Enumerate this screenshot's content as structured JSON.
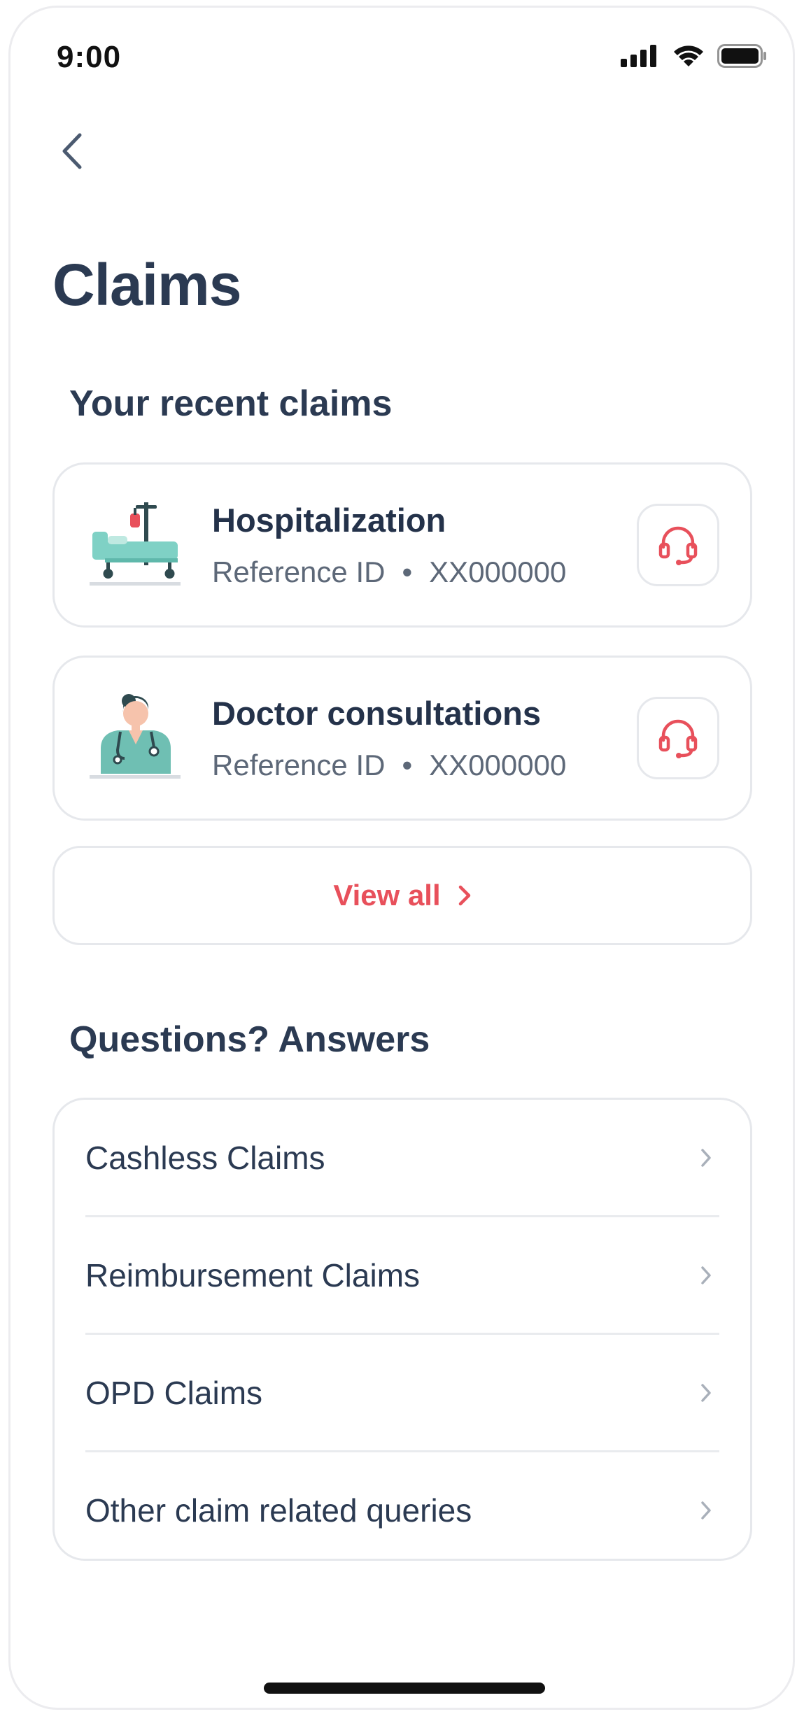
{
  "status_bar": {
    "time": "9:00",
    "icons": [
      "signal-icon",
      "wifi-icon",
      "battery-icon"
    ]
  },
  "nav": {
    "back_icon": "chevron-left-icon"
  },
  "page": {
    "title": "Claims"
  },
  "recent_claims": {
    "heading": "Your recent claims",
    "items": [
      {
        "title": "Hospitalization",
        "ref_label": "Reference ID",
        "separator": "•",
        "ref_value": "XX000000",
        "illustration": "hospital-bed-icon",
        "action_icon": "headset-icon"
      },
      {
        "title": "Doctor consultations",
        "ref_label": "Reference ID",
        "separator": "•",
        "ref_value": "XX000000",
        "illustration": "doctor-icon",
        "action_icon": "headset-icon"
      }
    ],
    "view_all_label": "View all"
  },
  "faq": {
    "heading": "Questions? Answers",
    "items": [
      {
        "label": "Cashless Claims"
      },
      {
        "label": "Reimbursement Claims"
      },
      {
        "label": "OPD Claims"
      },
      {
        "label": "Other claim related queries"
      }
    ]
  },
  "colors": {
    "accent": "#e8505b",
    "text_primary": "#2b3a52",
    "text_secondary": "#5d6878",
    "border": "#e6e8ec",
    "teal": "#7fd1c5"
  }
}
